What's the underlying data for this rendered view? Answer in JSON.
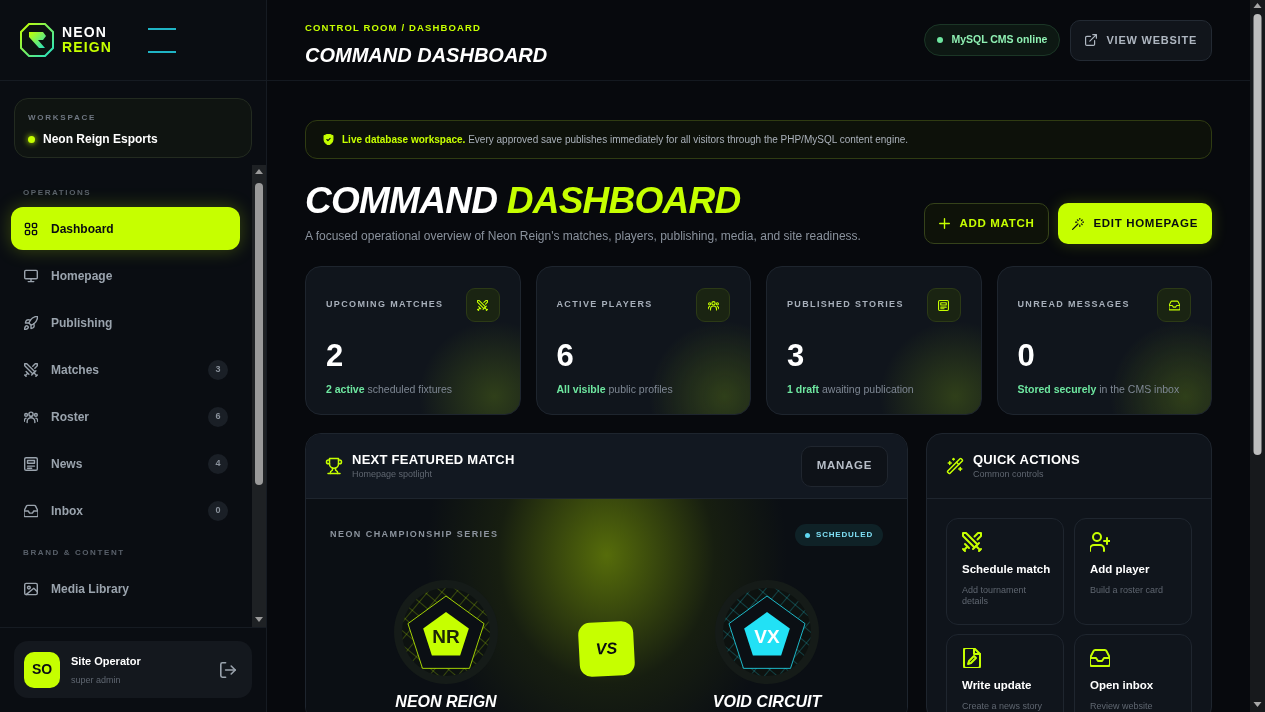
{
  "sidebar": {
    "brand": {
      "line_1": "NEON",
      "line_2": "REIGN"
    },
    "workspace": {
      "label": "WORKSPACE",
      "name": "Neon Reign Esports"
    },
    "sections": [
      {
        "label": "OPERATIONS",
        "items": [
          {
            "label": "Dashboard",
            "selected": true
          },
          {
            "label": "Homepage",
            "selected": false
          },
          {
            "label": "Publishing",
            "selected": false
          },
          {
            "label": "Matches",
            "badge": "3",
            "selected": false
          },
          {
            "label": "Roster",
            "badge": "6",
            "selected": false
          },
          {
            "label": "News",
            "badge": "4",
            "selected": false
          },
          {
            "label": "Inbox",
            "badge": "0",
            "selected": false
          }
        ]
      },
      {
        "label": "BRAND & CONTENT",
        "items": [
          {
            "label": "Media Library",
            "selected": false
          }
        ]
      }
    ],
    "user": {
      "initials": "SO",
      "name": "Site Operator",
      "role": "super admin"
    }
  },
  "header": {
    "breadcrumb": "CONTROL ROOM / DASHBOARD",
    "title": "COMMAND DASHBOARD",
    "status": "MySQL CMS online",
    "view_website": "VIEW WEBSITE"
  },
  "notice": "**Live database workspace.** Every approved save publishes immediately for all visitors through the PHP/MySQL content engine.",
  "hero": {
    "title": "COMMAND",
    "title_accent": "DASHBOARD",
    "subtitle": "A focused operational overview of Neon Reign's matches, players, publishing, media, and site readiness.",
    "actions": [
      {
        "label": "ADD MATCH",
        "kind": "outline"
      },
      {
        "label": "EDIT HOMEPAGE",
        "kind": "primary"
      }
    ]
  },
  "stats": [
    {
      "label": "UPCOMING MATCHES",
      "value": "2",
      "note": "**2 active** scheduled fixtures"
    },
    {
      "label": "ACTIVE PLAYERS",
      "value": "6",
      "note": "**All visible** public profiles"
    },
    {
      "label": "PUBLISHED STORIES",
      "value": "3",
      "note": "**1 draft** awaiting publication"
    },
    {
      "label": "UNREAD MESSAGES",
      "value": "0",
      "note": "**Stored securely** in the CMS inbox"
    }
  ],
  "featured_match": {
    "title": "NEXT FEATURED MATCH",
    "subtitle": "Homepage spotlight",
    "manage": "MANAGE",
    "series": "NEON CHAMPIONSHIP SERIES",
    "status": "SCHEDULED",
    "vs": "VS",
    "teams": [
      {
        "abbr": "NR",
        "name": "NEON REIGN",
        "color": "#c6ff00"
      },
      {
        "abbr": "VX",
        "name": "VOID CIRCUIT",
        "color": "#22e1f5"
      }
    ]
  },
  "quick_actions": {
    "title": "QUICK ACTIONS",
    "subtitle": "Common controls",
    "items": [
      {
        "title": "Schedule match",
        "description": "Add tournament details"
      },
      {
        "title": "Add player",
        "description": "Build a roster card"
      },
      {
        "title": "Write update",
        "description": "Create a news story"
      },
      {
        "title": "Open inbox",
        "description": "Review website"
      }
    ]
  }
}
